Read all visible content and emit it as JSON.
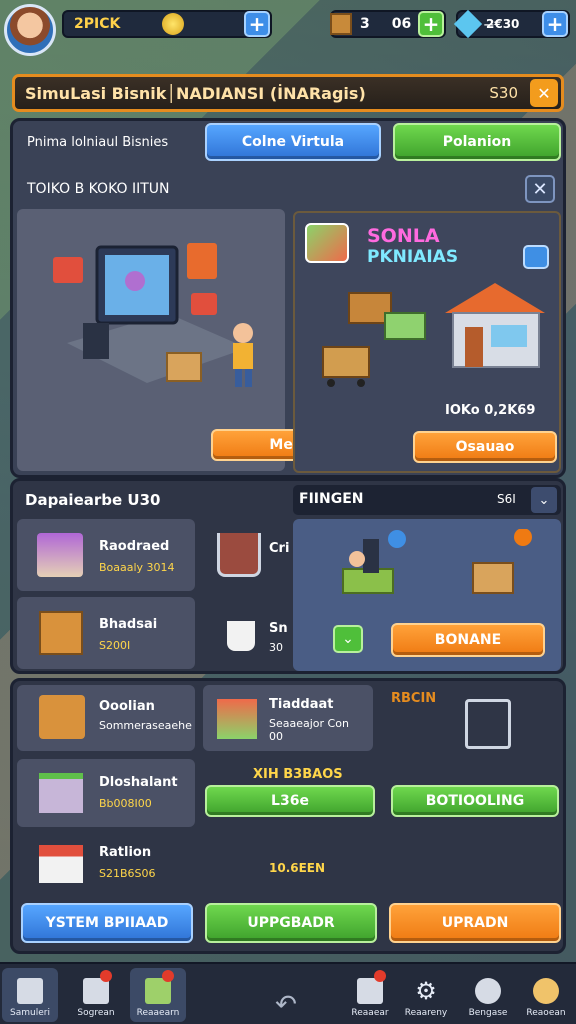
{
  "topbar": {
    "resource_1": "2PICK",
    "resource_2": "3",
    "resource_2b": "06",
    "resource_3": "2̶€30"
  },
  "title": {
    "text": "SimuLasi Bisnik│NADIANSI (İNARagis)",
    "amount": "S30"
  },
  "section1": {
    "heading": "Pnima lolniaul Bisnies",
    "tab_blue": "Colne Virtula",
    "tab_green": "Polanion",
    "subheading": "TOIKO B KOKO IITUN",
    "card_left_button": "Meaaeim",
    "card_right_title_1": "SONLA",
    "card_right_title_2": "PKNIAIAS",
    "card_right_caption": "IOKo 0,2K69",
    "card_right_button": "Osauao"
  },
  "section2": {
    "heading": "Dapaiearbe U30",
    "right_heading": "FIINGEN",
    "right_value": "S6I",
    "items": [
      {
        "name": "Raodraed",
        "price": "Boaaaly 3014"
      },
      {
        "name": "Bhadsai",
        "price": "S200I"
      }
    ],
    "side_items": [
      {
        "name": "Cri",
        "price": ""
      },
      {
        "name": "Sn",
        "price": "30"
      }
    ],
    "right_button": "BONANE"
  },
  "section3": {
    "items": [
      {
        "name": "Ooolian",
        "price": "Sommeraseaehe"
      },
      {
        "name": "Tiaddaat",
        "price": "Seaaeajor Con\n00"
      },
      {
        "name": "Dloshalant",
        "price": "Bb008I00"
      },
      {
        "name": "Ratlion",
        "price": "S21B6S06"
      }
    ],
    "right_label": "RBCIN",
    "mid_label": "XIH B3BAOS",
    "mid_button": "L36e",
    "green_button": "BOTIOOLING",
    "price_mid": "10.6EEN",
    "btn_blue": "YSTEM BPIIAAD",
    "btn_green": "UPPGBADR",
    "btn_orange": "UPRADN"
  },
  "nav": [
    {
      "label": "Samuleri"
    },
    {
      "label": "Sogrean"
    },
    {
      "label": "Reaaearn"
    },
    {
      "label": ""
    },
    {
      "label": "Reaaear"
    },
    {
      "label": "Reaareny"
    },
    {
      "label": "Bengase"
    },
    {
      "label": "Reaoean"
    }
  ],
  "colors": {
    "accent_orange": "#ef7a12",
    "accent_green": "#3ea12c",
    "accent_blue": "#2f73d6",
    "panel": "#3a4256"
  }
}
